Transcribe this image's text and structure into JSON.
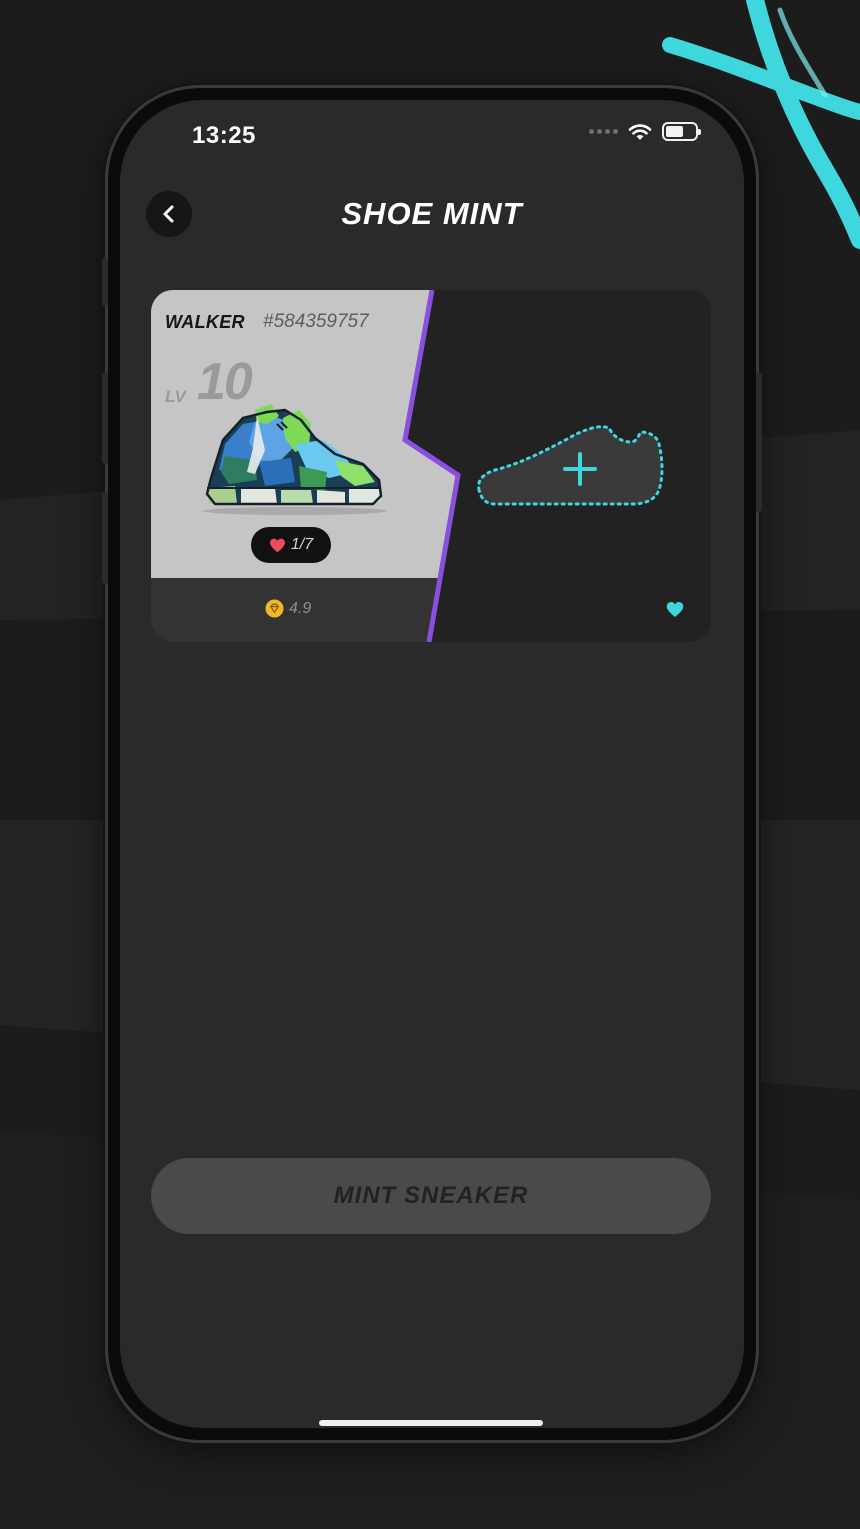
{
  "status_bar": {
    "time": "13:25",
    "icons": [
      "signal-dots",
      "wifi-icon",
      "battery-icon"
    ],
    "battery_level": 0.6
  },
  "header": {
    "title": "SHOE MINT",
    "back_icon": "chevron-left-icon"
  },
  "sneaker_slot": {
    "type": "WALKER",
    "id": "#584359757",
    "level_label": "LV",
    "level": "10",
    "mint_count": "1/7",
    "rating": "4.9",
    "rating_icon": "gem-token-icon",
    "mint_icon": "heart-icon"
  },
  "empty_slot": {
    "add_icon": "plus-icon",
    "placeholder_icon": "shoe-outline-icon",
    "status_icon": "heart-icon"
  },
  "mint_button": {
    "label": "MINT SNEAKER",
    "enabled": false
  },
  "colors": {
    "background": "#1c1c1d",
    "screen": "#2a2a2b",
    "card_light": "#c6c5c5",
    "accent_purple": "#8b4fe0",
    "accent_cyan": "#3fd7de",
    "heart_red": "#ef4b5c",
    "rating_gold": "#f0b829",
    "button_disabled": "#4b4a4a"
  }
}
